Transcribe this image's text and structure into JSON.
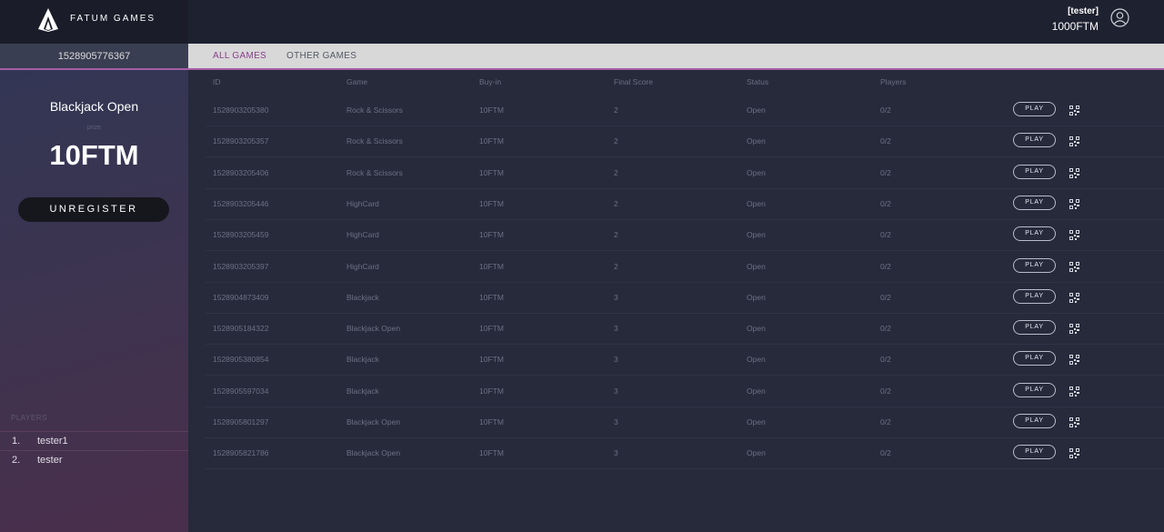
{
  "header": {
    "brand": "FATUM GAMES",
    "user": "[tester]",
    "balance": "1000FTM",
    "icons": {
      "logo": "fatum-logo-icon",
      "account": "account-circle-icon"
    }
  },
  "subbar": {
    "session_id": "1528905776367",
    "tabs": [
      {
        "label": "ALL GAMES",
        "active": true
      },
      {
        "label": "OTHER GAMES",
        "active": false
      }
    ]
  },
  "sidebar": {
    "title": "Blackjack Open",
    "caption": "prize",
    "prize": "10FTM",
    "unregister_label": "UNREGISTER",
    "players_label": "PLAYERS",
    "players": [
      {
        "num": "1.",
        "name": "tester1"
      },
      {
        "num": "2.",
        "name": "tester"
      }
    ]
  },
  "table": {
    "headers": {
      "id": "ID",
      "game": "Game",
      "buyin": "Buy-in",
      "score": "Final Score",
      "status": "Status",
      "players": "Players"
    },
    "play_label": "PLAY",
    "rows": [
      {
        "id": "1528903205380",
        "game": "Rock & Scissors",
        "buyin": "10FTM",
        "score": "2",
        "status": "Open",
        "players": "0/2"
      },
      {
        "id": "1528903205357",
        "game": "Rock & Scissors",
        "buyin": "10FTM",
        "score": "2",
        "status": "Open",
        "players": "0/2"
      },
      {
        "id": "1528903205406",
        "game": "Rock & Scissors",
        "buyin": "10FTM",
        "score": "2",
        "status": "Open",
        "players": "0/2"
      },
      {
        "id": "1528903205446",
        "game": "HighCard",
        "buyin": "10FTM",
        "score": "2",
        "status": "Open",
        "players": "0/2"
      },
      {
        "id": "1528903205459",
        "game": "HighCard",
        "buyin": "10FTM",
        "score": "2",
        "status": "Open",
        "players": "0/2"
      },
      {
        "id": "1528903205397",
        "game": "HighCard",
        "buyin": "10FTM",
        "score": "2",
        "status": "Open",
        "players": "0/2"
      },
      {
        "id": "1528904873409",
        "game": "Blackjack",
        "buyin": "10FTM",
        "score": "3",
        "status": "Open",
        "players": "0/2"
      },
      {
        "id": "1528905184322",
        "game": "Blackjack Open",
        "buyin": "10FTM",
        "score": "3",
        "status": "Open",
        "players": "0/2"
      },
      {
        "id": "1528905380854",
        "game": "Blackjack",
        "buyin": "10FTM",
        "score": "3",
        "status": "Open",
        "players": "0/2"
      },
      {
        "id": "1528905597034",
        "game": "Blackjack",
        "buyin": "10FTM",
        "score": "3",
        "status": "Open",
        "players": "0/2"
      },
      {
        "id": "1528905801297",
        "game": "Blackjack Open",
        "buyin": "10FTM",
        "score": "3",
        "status": "Open",
        "players": "0/2"
      },
      {
        "id": "1528905821786",
        "game": "Blackjack Open",
        "buyin": "10FTM",
        "score": "3",
        "status": "Open",
        "players": "0/2"
      }
    ]
  },
  "colors": {
    "accent": "#a55ca6",
    "background": "#262a3b",
    "header": "#1e2130"
  }
}
